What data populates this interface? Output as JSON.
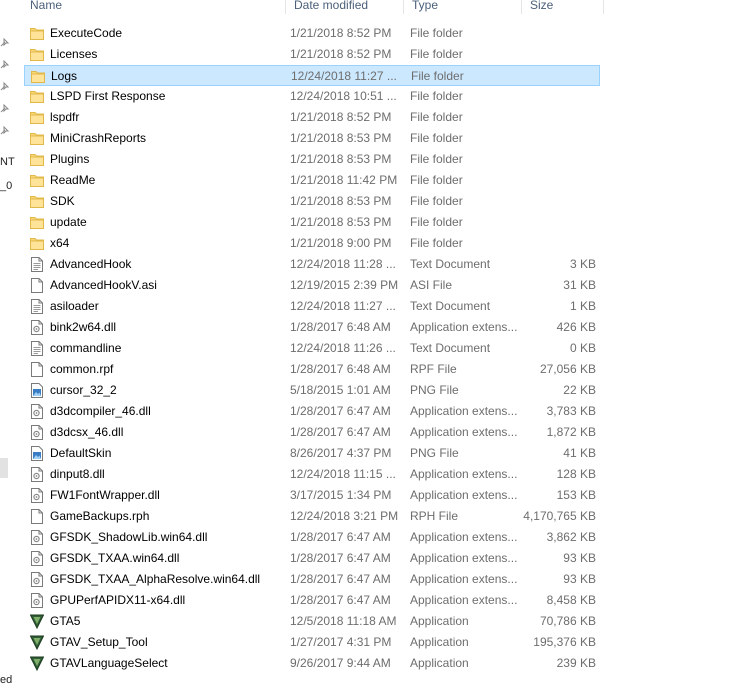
{
  "columns": {
    "name": "Name",
    "date": "Date modified",
    "type": "Type",
    "size": "Size"
  },
  "nav": {
    "mark_nt": "NT",
    "mark_0": "_0",
    "mark_ed": "ed"
  },
  "rows": [
    {
      "name": "ExecuteCode",
      "date": "1/21/2018 8:52 PM",
      "type": "File folder",
      "size": "",
      "icon": "folder-icon"
    },
    {
      "name": "Licenses",
      "date": "1/21/2018 8:52 PM",
      "type": "File folder",
      "size": "",
      "icon": "folder-icon"
    },
    {
      "name": "Logs",
      "date": "12/24/2018 11:27 ...",
      "type": "File folder",
      "size": "",
      "icon": "folder-icon",
      "selected": true
    },
    {
      "name": "LSPD First Response",
      "date": "12/24/2018 10:51 ...",
      "type": "File folder",
      "size": "",
      "icon": "folder-icon"
    },
    {
      "name": "lspdfr",
      "date": "1/21/2018 8:52 PM",
      "type": "File folder",
      "size": "",
      "icon": "folder-icon"
    },
    {
      "name": "MiniCrashReports",
      "date": "1/21/2018 8:53 PM",
      "type": "File folder",
      "size": "",
      "icon": "folder-icon"
    },
    {
      "name": "Plugins",
      "date": "1/21/2018 8:53 PM",
      "type": "File folder",
      "size": "",
      "icon": "folder-icon"
    },
    {
      "name": "ReadMe",
      "date": "1/21/2018 11:42 PM",
      "type": "File folder",
      "size": "",
      "icon": "folder-icon"
    },
    {
      "name": "SDK",
      "date": "1/21/2018 8:53 PM",
      "type": "File folder",
      "size": "",
      "icon": "folder-icon"
    },
    {
      "name": "update",
      "date": "1/21/2018 8:53 PM",
      "type": "File folder",
      "size": "",
      "icon": "folder-icon"
    },
    {
      "name": "x64",
      "date": "1/21/2018 9:00 PM",
      "type": "File folder",
      "size": "",
      "icon": "folder-icon"
    },
    {
      "name": "AdvancedHook",
      "date": "12/24/2018 11:28 ...",
      "type": "Text Document",
      "size": "3 KB",
      "icon": "text-file-icon"
    },
    {
      "name": "AdvancedHookV.asi",
      "date": "12/19/2015 2:39 PM",
      "type": "ASI File",
      "size": "31 KB",
      "icon": "blank-file-icon"
    },
    {
      "name": "asiloader",
      "date": "12/24/2018 11:27 ...",
      "type": "Text Document",
      "size": "1 KB",
      "icon": "text-file-icon"
    },
    {
      "name": "bink2w64.dll",
      "date": "1/28/2017 6:48 AM",
      "type": "Application extens...",
      "size": "426 KB",
      "icon": "dll-file-icon"
    },
    {
      "name": "commandline",
      "date": "12/24/2018 11:26 ...",
      "type": "Text Document",
      "size": "0 KB",
      "icon": "text-file-icon"
    },
    {
      "name": "common.rpf",
      "date": "1/28/2017 6:48 AM",
      "type": "RPF File",
      "size": "27,056 KB",
      "icon": "blank-file-icon"
    },
    {
      "name": "cursor_32_2",
      "date": "5/18/2015 1:01 AM",
      "type": "PNG File",
      "size": "22 KB",
      "icon": "image-file-icon"
    },
    {
      "name": "d3dcompiler_46.dll",
      "date": "1/28/2017 6:47 AM",
      "type": "Application extens...",
      "size": "3,783 KB",
      "icon": "dll-file-icon"
    },
    {
      "name": "d3dcsx_46.dll",
      "date": "1/28/2017 6:47 AM",
      "type": "Application extens...",
      "size": "1,872 KB",
      "icon": "dll-file-icon"
    },
    {
      "name": "DefaultSkin",
      "date": "8/26/2017 4:37 PM",
      "type": "PNG File",
      "size": "41 KB",
      "icon": "image-file-icon"
    },
    {
      "name": "dinput8.dll",
      "date": "12/24/2018 11:15 ...",
      "type": "Application extens...",
      "size": "128 KB",
      "icon": "dll-file-icon"
    },
    {
      "name": "FW1FontWrapper.dll",
      "date": "3/17/2015 1:34 PM",
      "type": "Application extens...",
      "size": "153 KB",
      "icon": "dll-file-icon"
    },
    {
      "name": "GameBackups.rph",
      "date": "12/24/2018 3:21 PM",
      "type": "RPH File",
      "size": "4,170,765 KB",
      "icon": "blank-file-icon"
    },
    {
      "name": "GFSDK_ShadowLib.win64.dll",
      "date": "1/28/2017 6:47 AM",
      "type": "Application extens...",
      "size": "3,862 KB",
      "icon": "dll-file-icon"
    },
    {
      "name": "GFSDK_TXAA.win64.dll",
      "date": "1/28/2017 6:47 AM",
      "type": "Application extens...",
      "size": "93 KB",
      "icon": "dll-file-icon"
    },
    {
      "name": "GFSDK_TXAA_AlphaResolve.win64.dll",
      "date": "1/28/2017 6:47 AM",
      "type": "Application extens...",
      "size": "93 KB",
      "icon": "dll-file-icon"
    },
    {
      "name": "GPUPerfAPIDX11-x64.dll",
      "date": "1/28/2017 6:47 AM",
      "type": "Application extens...",
      "size": "8,458 KB",
      "icon": "dll-file-icon"
    },
    {
      "name": "GTA5",
      "date": "12/5/2018 11:18 AM",
      "type": "Application",
      "size": "70,786 KB",
      "icon": "gta-app-icon"
    },
    {
      "name": "GTAV_Setup_Tool",
      "date": "1/27/2017 4:31 PM",
      "type": "Application",
      "size": "195,376 KB",
      "icon": "gta-app-icon"
    },
    {
      "name": "GTAVLanguageSelect",
      "date": "9/26/2017 9:44 AM",
      "type": "Application",
      "size": "239 KB",
      "icon": "gta-app-icon"
    }
  ],
  "colors": {
    "selected_bg": "#cce8ff",
    "selected_border": "#99d1ff",
    "header_text": "#4c607a",
    "secondary_text": "#6d6d6d",
    "folder_yellow": "#f8d775"
  }
}
